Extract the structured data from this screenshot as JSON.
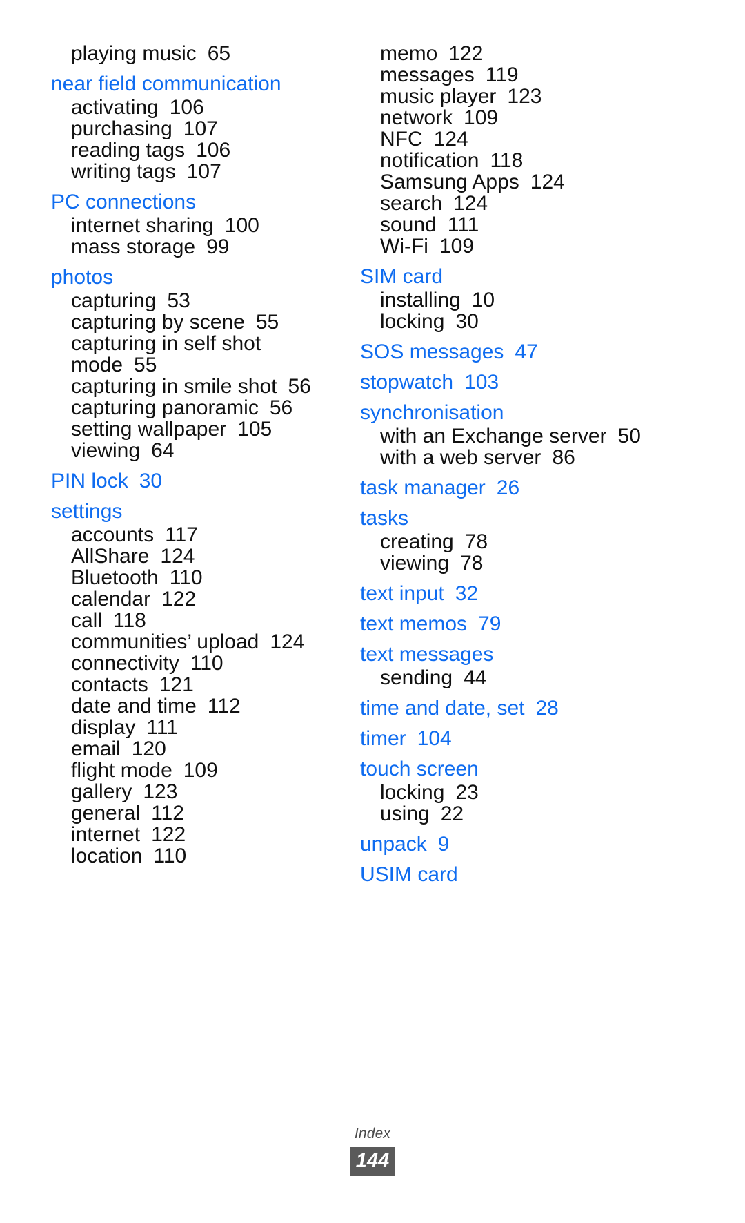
{
  "document": {
    "footer_label": "Index",
    "footer_page": "144",
    "accent_color": "#0f6cf0",
    "text_color": "#111111",
    "footer_box_color": "#5a5a5a"
  },
  "columns": [
    {
      "name": "left-column",
      "entries": [
        {
          "level": 1,
          "label": "playing music",
          "page": "65"
        },
        {
          "level": 0,
          "label": "near field communication",
          "page": ""
        },
        {
          "level": 1,
          "label": "activating",
          "page": "106"
        },
        {
          "level": 1,
          "label": "purchasing",
          "page": "107"
        },
        {
          "level": 1,
          "label": "reading tags",
          "page": "106"
        },
        {
          "level": 1,
          "label": "writing tags",
          "page": "107"
        },
        {
          "level": 0,
          "label": "PC connections",
          "page": ""
        },
        {
          "level": 1,
          "label": "internet sharing",
          "page": "100"
        },
        {
          "level": 1,
          "label": "mass storage",
          "page": "99"
        },
        {
          "level": 0,
          "label": "photos",
          "page": ""
        },
        {
          "level": 1,
          "label": "capturing",
          "page": "53"
        },
        {
          "level": 1,
          "label": "capturing by scene",
          "page": "55"
        },
        {
          "level": 1,
          "label": "capturing in self shot",
          "page": ""
        },
        {
          "level": 2,
          "label": "mode",
          "page": "55"
        },
        {
          "level": 1,
          "label": "capturing in smile shot",
          "page": "56"
        },
        {
          "level": 1,
          "label": "capturing panoramic",
          "page": "56"
        },
        {
          "level": 1,
          "label": "setting wallpaper",
          "page": "105"
        },
        {
          "level": 1,
          "label": "viewing",
          "page": "64"
        },
        {
          "level": 0,
          "label": "PIN lock",
          "page": "30"
        },
        {
          "level": 0,
          "label": "settings",
          "page": ""
        },
        {
          "level": 1,
          "label": "accounts",
          "page": "117"
        },
        {
          "level": 1,
          "label": "AllShare",
          "page": "124"
        },
        {
          "level": 1,
          "label": "Bluetooth",
          "page": "110"
        },
        {
          "level": 1,
          "label": "calendar",
          "page": "122"
        },
        {
          "level": 1,
          "label": "call",
          "page": "118"
        },
        {
          "level": 1,
          "label": "communities’ upload",
          "page": "124"
        },
        {
          "level": 1,
          "label": "connectivity",
          "page": "110"
        },
        {
          "level": 1,
          "label": "contacts",
          "page": "121"
        },
        {
          "level": 1,
          "label": "date and time",
          "page": "112"
        },
        {
          "level": 1,
          "label": "display",
          "page": "111"
        },
        {
          "level": 1,
          "label": "email",
          "page": "120"
        },
        {
          "level": 1,
          "label": "flight mode",
          "page": "109"
        },
        {
          "level": 1,
          "label": "gallery",
          "page": "123"
        },
        {
          "level": 1,
          "label": "general",
          "page": "112"
        },
        {
          "level": 1,
          "label": "internet",
          "page": "122"
        },
        {
          "level": 1,
          "label": "location",
          "page": "110"
        }
      ]
    },
    {
      "name": "right-column",
      "entries": [
        {
          "level": 1,
          "label": "memo",
          "page": "122"
        },
        {
          "level": 1,
          "label": "messages",
          "page": "119"
        },
        {
          "level": 1,
          "label": "music player",
          "page": "123"
        },
        {
          "level": 1,
          "label": "network",
          "page": "109"
        },
        {
          "level": 1,
          "label": "NFC",
          "page": "124"
        },
        {
          "level": 1,
          "label": "notification",
          "page": "118"
        },
        {
          "level": 1,
          "label": "Samsung Apps",
          "page": "124"
        },
        {
          "level": 1,
          "label": "search",
          "page": "124"
        },
        {
          "level": 1,
          "label": "sound",
          "page": "111"
        },
        {
          "level": 1,
          "label": "Wi-Fi",
          "page": "109"
        },
        {
          "level": 0,
          "label": "SIM card",
          "page": ""
        },
        {
          "level": 1,
          "label": "installing",
          "page": "10"
        },
        {
          "level": 1,
          "label": "locking",
          "page": "30"
        },
        {
          "level": 0,
          "label": "SOS messages",
          "page": "47"
        },
        {
          "level": 0,
          "label": "stopwatch",
          "page": "103"
        },
        {
          "level": 0,
          "label": "synchronisation",
          "page": ""
        },
        {
          "level": 1,
          "label": "with an Exchange server",
          "page": "50"
        },
        {
          "level": 1,
          "label": "with a web server",
          "page": "86"
        },
        {
          "level": 0,
          "label": "task manager",
          "page": "26"
        },
        {
          "level": 0,
          "label": "tasks",
          "page": ""
        },
        {
          "level": 1,
          "label": "creating",
          "page": "78"
        },
        {
          "level": 1,
          "label": "viewing",
          "page": "78"
        },
        {
          "level": 0,
          "label": "text input",
          "page": "32"
        },
        {
          "level": 0,
          "label": "text memos",
          "page": "79"
        },
        {
          "level": 0,
          "label": "text messages",
          "page": ""
        },
        {
          "level": 1,
          "label": "sending",
          "page": "44"
        },
        {
          "level": 0,
          "label": "time and date, set",
          "page": "28"
        },
        {
          "level": 0,
          "label": "timer",
          "page": "104"
        },
        {
          "level": 0,
          "label": "touch screen",
          "page": ""
        },
        {
          "level": 1,
          "label": "locking",
          "page": "23"
        },
        {
          "level": 1,
          "label": "using",
          "page": "22"
        },
        {
          "level": 0,
          "label": "unpack",
          "page": "9"
        },
        {
          "level": 0,
          "label": "USIM card",
          "page": ""
        }
      ]
    }
  ]
}
